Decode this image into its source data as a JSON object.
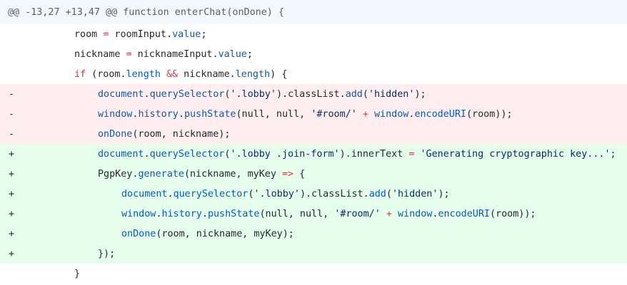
{
  "hunk": {
    "header": "@@ -13,27 +13,47 @@ function enterChat(onDone) {"
  },
  "colors": {
    "hunk_bg": "#f1f8ff",
    "deleted_bg": "#ffeef0",
    "added_bg": "#e6ffed",
    "property": "#005cc5",
    "keyword": "#d73a49",
    "string": "#032f62"
  },
  "lines": [
    {
      "type": "ctx",
      "marker": "",
      "indent": 2,
      "tokens": [
        {
          "t": "room ",
          "c": "plain"
        },
        {
          "t": "=",
          "c": "op"
        },
        {
          "t": " roomInput.",
          "c": "plain"
        },
        {
          "t": "value",
          "c": "prop"
        },
        {
          "t": ";",
          "c": "plain"
        }
      ]
    },
    {
      "type": "ctx",
      "marker": "",
      "indent": 2,
      "tokens": [
        {
          "t": "nickname ",
          "c": "plain"
        },
        {
          "t": "=",
          "c": "op"
        },
        {
          "t": " nicknameInput.",
          "c": "plain"
        },
        {
          "t": "value",
          "c": "prop"
        },
        {
          "t": ";",
          "c": "plain"
        }
      ]
    },
    {
      "type": "ctx",
      "marker": "",
      "indent": 2,
      "tokens": [
        {
          "t": "if",
          "c": "kw"
        },
        {
          "t": " (room.",
          "c": "plain"
        },
        {
          "t": "length",
          "c": "prop"
        },
        {
          "t": " ",
          "c": "plain"
        },
        {
          "t": "&&",
          "c": "op"
        },
        {
          "t": " nickname.",
          "c": "plain"
        },
        {
          "t": "length",
          "c": "prop"
        },
        {
          "t": ") {",
          "c": "plain"
        }
      ]
    },
    {
      "type": "del",
      "marker": "-",
      "indent": 3,
      "tokens": [
        {
          "t": "document",
          "c": "prop"
        },
        {
          "t": ".",
          "c": "plain"
        },
        {
          "t": "querySelector",
          "c": "prop"
        },
        {
          "t": "(",
          "c": "plain"
        },
        {
          "t": "'.lobby'",
          "c": "str"
        },
        {
          "t": ").classList.",
          "c": "plain"
        },
        {
          "t": "add",
          "c": "prop"
        },
        {
          "t": "(",
          "c": "plain"
        },
        {
          "t": "'hidden'",
          "c": "str"
        },
        {
          "t": ");",
          "c": "plain"
        }
      ]
    },
    {
      "type": "del",
      "marker": "-",
      "indent": 3,
      "tokens": [
        {
          "t": "window",
          "c": "prop"
        },
        {
          "t": ".",
          "c": "plain"
        },
        {
          "t": "history",
          "c": "prop"
        },
        {
          "t": ".",
          "c": "plain"
        },
        {
          "t": "pushState",
          "c": "prop"
        },
        {
          "t": "(null, null, ",
          "c": "plain"
        },
        {
          "t": "'#room/'",
          "c": "str"
        },
        {
          "t": " ",
          "c": "plain"
        },
        {
          "t": "+",
          "c": "op"
        },
        {
          "t": " ",
          "c": "plain"
        },
        {
          "t": "window",
          "c": "prop"
        },
        {
          "t": ".",
          "c": "plain"
        },
        {
          "t": "encodeURI",
          "c": "prop"
        },
        {
          "t": "(room));",
          "c": "plain"
        }
      ]
    },
    {
      "type": "del",
      "marker": "-",
      "indent": 3,
      "tokens": [
        {
          "t": "onDone",
          "c": "prop"
        },
        {
          "t": "(room, nickname);",
          "c": "plain"
        }
      ]
    },
    {
      "type": "add",
      "marker": "+",
      "indent": 3,
      "tokens": [
        {
          "t": "document",
          "c": "prop"
        },
        {
          "t": ".",
          "c": "plain"
        },
        {
          "t": "querySelector",
          "c": "prop"
        },
        {
          "t": "(",
          "c": "plain"
        },
        {
          "t": "'.lobby .join-form'",
          "c": "str"
        },
        {
          "t": ").innerText ",
          "c": "plain"
        },
        {
          "t": "=",
          "c": "op"
        },
        {
          "t": " ",
          "c": "plain"
        },
        {
          "t": "'Generating cryptographic key...'",
          "c": "str"
        },
        {
          "t": ";",
          "c": "plain"
        }
      ]
    },
    {
      "type": "add",
      "marker": "+",
      "indent": 3,
      "tokens": [
        {
          "t": "PgpKey.",
          "c": "plain"
        },
        {
          "t": "generate",
          "c": "prop"
        },
        {
          "t": "(nickname, myKey ",
          "c": "plain"
        },
        {
          "t": "=>",
          "c": "op"
        },
        {
          "t": " {",
          "c": "plain"
        }
      ]
    },
    {
      "type": "add",
      "marker": "+",
      "indent": 4,
      "tokens": [
        {
          "t": "document",
          "c": "prop"
        },
        {
          "t": ".",
          "c": "plain"
        },
        {
          "t": "querySelector",
          "c": "prop"
        },
        {
          "t": "(",
          "c": "plain"
        },
        {
          "t": "'.lobby'",
          "c": "str"
        },
        {
          "t": ").classList.",
          "c": "plain"
        },
        {
          "t": "add",
          "c": "prop"
        },
        {
          "t": "(",
          "c": "plain"
        },
        {
          "t": "'hidden'",
          "c": "str"
        },
        {
          "t": ");",
          "c": "plain"
        }
      ]
    },
    {
      "type": "add",
      "marker": "+",
      "indent": 4,
      "tokens": [
        {
          "t": "window",
          "c": "prop"
        },
        {
          "t": ".",
          "c": "plain"
        },
        {
          "t": "history",
          "c": "prop"
        },
        {
          "t": ".",
          "c": "plain"
        },
        {
          "t": "pushState",
          "c": "prop"
        },
        {
          "t": "(null, null, ",
          "c": "plain"
        },
        {
          "t": "'#room/'",
          "c": "str"
        },
        {
          "t": " ",
          "c": "plain"
        },
        {
          "t": "+",
          "c": "op"
        },
        {
          "t": " ",
          "c": "plain"
        },
        {
          "t": "window",
          "c": "prop"
        },
        {
          "t": ".",
          "c": "plain"
        },
        {
          "t": "encodeURI",
          "c": "prop"
        },
        {
          "t": "(room));",
          "c": "plain"
        }
      ]
    },
    {
      "type": "add",
      "marker": "+",
      "indent": 4,
      "tokens": [
        {
          "t": "onDone",
          "c": "prop"
        },
        {
          "t": "(room, nickname, myKey);",
          "c": "plain"
        }
      ]
    },
    {
      "type": "add",
      "marker": "+",
      "indent": 3,
      "tokens": [
        {
          "t": "});",
          "c": "plain"
        }
      ]
    },
    {
      "type": "ctx",
      "marker": "",
      "indent": 2,
      "tokens": [
        {
          "t": "}",
          "c": "plain"
        }
      ]
    }
  ]
}
